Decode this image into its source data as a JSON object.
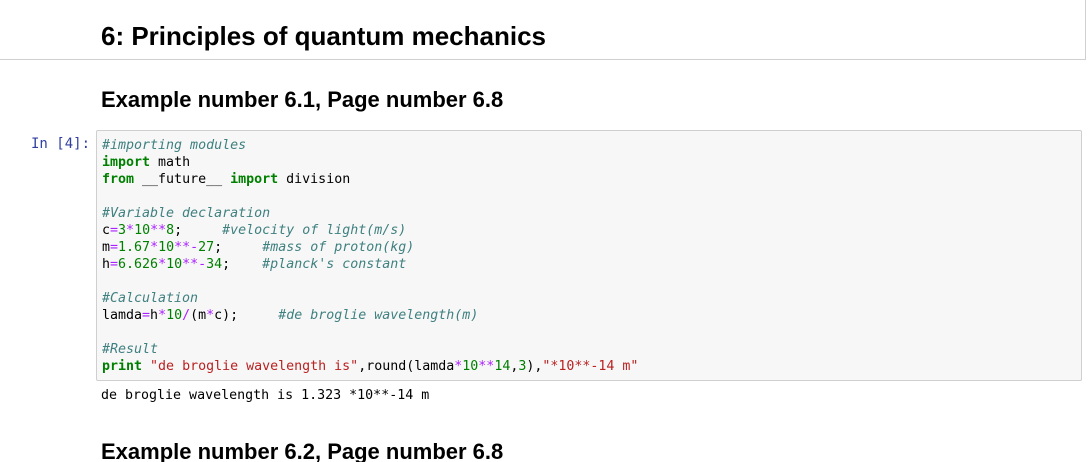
{
  "chapter_title": "6: Principles of quantum mechanics",
  "example1_heading": "Example number 6.1, Page number 6.8",
  "cell": {
    "prompt": "In [4]:",
    "code": {
      "l1_comment": "#importing modules",
      "l2_kw": "import",
      "l2_rest": " math",
      "l3_kw1": "from",
      "l3_mid": " __future__ ",
      "l3_kw2": "import",
      "l3_rest": " division",
      "l5_comment": "#Variable declaration",
      "l6_a": "c",
      "l6_eq": "=",
      "l6_n1": "3",
      "l6_op1": "*",
      "l6_n2": "10",
      "l6_op2": "**",
      "l6_n3": "8",
      "l6_semi": ";     ",
      "l6_comment": "#velocity of light(m/s)",
      "l7_a": "m",
      "l7_eq": "=",
      "l7_n1": "1.67",
      "l7_op1": "*",
      "l7_n2": "10",
      "l7_op2": "**-",
      "l7_n3": "27",
      "l7_semi": ";     ",
      "l7_comment": "#mass of proton(kg)",
      "l8_a": "h",
      "l8_eq": "=",
      "l8_n1": "6.626",
      "l8_op1": "*",
      "l8_n2": "10",
      "l8_op2": "**-",
      "l8_n3": "34",
      "l8_semi": ";    ",
      "l8_comment": "#planck's constant",
      "l10_comment": "#Calculation",
      "l11_a": "lamda",
      "l11_eq": "=",
      "l11_b": "h",
      "l11_op1": "*",
      "l11_n1": "10",
      "l11_op2": "/",
      "l11_c": "(m",
      "l11_op3": "*",
      "l11_d": "c);     ",
      "l11_comment": "#de broglie wavelength(m)",
      "l13_comment": "#Result",
      "l14_kw": "print",
      "l14_sp": " ",
      "l14_s1": "\"de broglie wavelength is\"",
      "l14_mid": ",round(lamda",
      "l14_op1": "*",
      "l14_n1": "10",
      "l14_op2": "**",
      "l14_n2": "14",
      "l14_mid2": ",",
      "l14_n3": "3",
      "l14_mid3": "),",
      "l14_s2": "\"*10**-14 m\""
    },
    "output": "de broglie wavelength is 1.323 *10**-14 m"
  },
  "example2_heading": "Example number 6.2, Page number 6.8"
}
